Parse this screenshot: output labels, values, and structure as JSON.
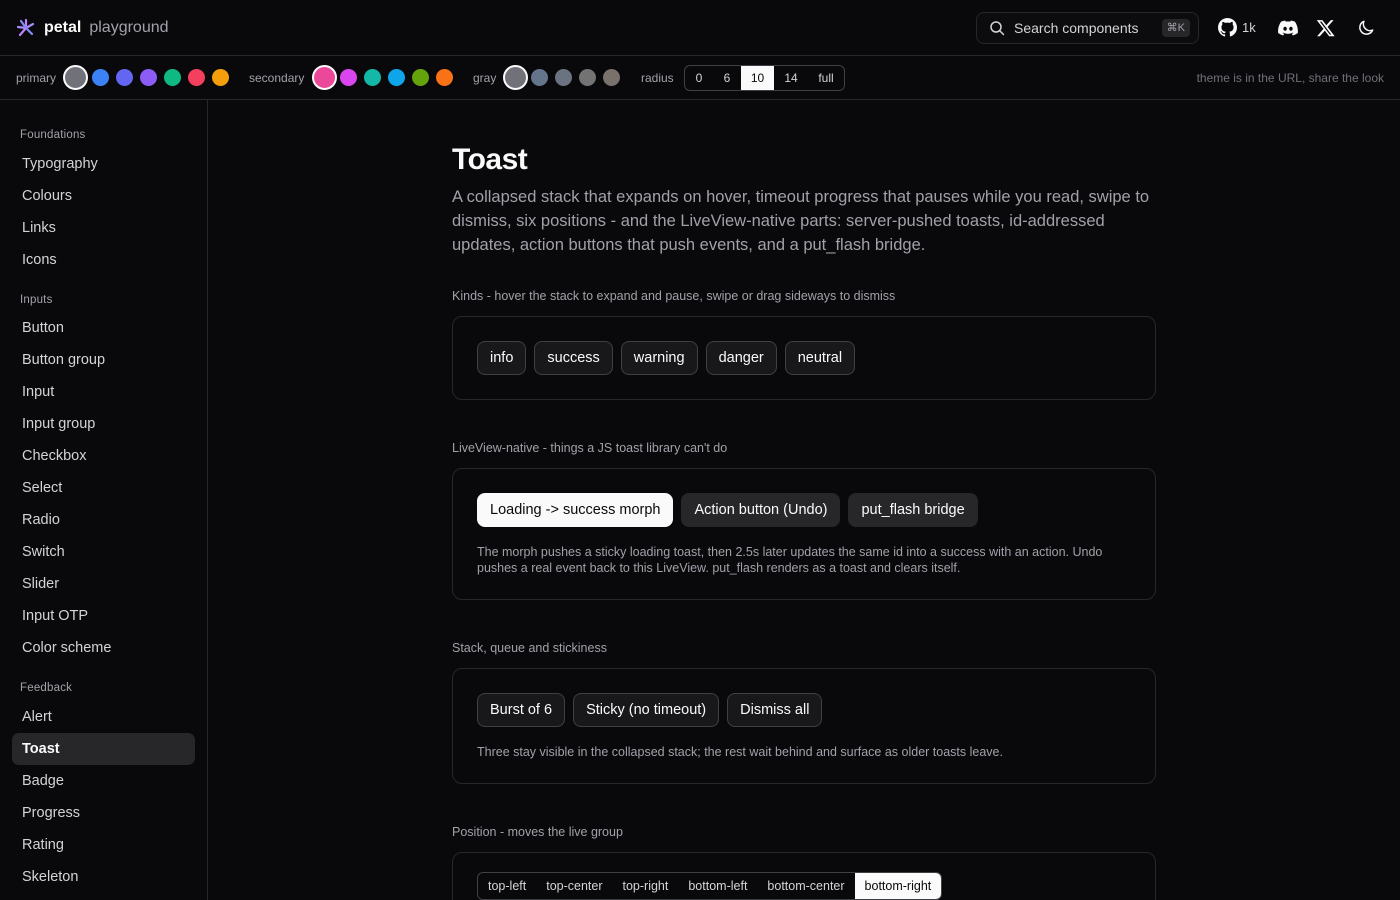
{
  "header": {
    "brand_name": "petal",
    "brand_sub": "playground",
    "search_placeholder": "Search components",
    "search_shortcut": "⌘K",
    "github_count": "1k",
    "icons": [
      "sparkle-logo-icon",
      "search-icon",
      "github-icon",
      "discord-icon",
      "x-icon",
      "moon-icon"
    ]
  },
  "themebar": {
    "primary_label": "primary",
    "primary_colors": [
      "#71717a",
      "#3b82f6",
      "#6366f1",
      "#8b5cf6",
      "#10b981",
      "#f43f5e",
      "#f59e0b"
    ],
    "secondary_label": "secondary",
    "secondary_colors": [
      "#ec4899",
      "#d946ef",
      "#14b8a6",
      "#0ea5e9",
      "#65a30d",
      "#f97316"
    ],
    "gray_label": "gray",
    "gray_colors": [
      "#71717a",
      "#64748b",
      "#6b7280",
      "#737373",
      "#78716c"
    ],
    "radius_label": "radius",
    "radius_options": [
      "0",
      "6",
      "10",
      "14",
      "full"
    ],
    "radius_selected": "10",
    "share_note": "theme is in the URL, share the look"
  },
  "sidebar": {
    "sections": [
      {
        "title": "Foundations",
        "items": [
          "Typography",
          "Colours",
          "Links",
          "Icons"
        ]
      },
      {
        "title": "Inputs",
        "items": [
          "Button",
          "Button group",
          "Input",
          "Input group",
          "Checkbox",
          "Select",
          "Radio",
          "Switch",
          "Slider",
          "Input OTP",
          "Color scheme"
        ]
      },
      {
        "title": "Feedback",
        "items": [
          "Alert",
          "Toast",
          "Badge",
          "Progress",
          "Rating",
          "Skeleton"
        ]
      }
    ],
    "active_item": "Toast"
  },
  "main": {
    "title": "Toast",
    "description": "A collapsed stack that expands on hover, timeout progress that pauses while you read, swipe to dismiss, six positions - and the LiveView-native parts: server-pushed toasts, id-addressed updates, action buttons that push events, and a put_flash bridge.",
    "kinds": {
      "label": "Kinds - hover the stack to expand and pause, swipe or drag sideways to dismiss",
      "buttons": [
        "info",
        "success",
        "warning",
        "danger",
        "neutral"
      ]
    },
    "liveview": {
      "label": "LiveView-native - things a JS toast library can't do",
      "buttons": [
        "Loading -> success morph",
        "Action button (Undo)",
        "put_flash bridge"
      ],
      "note": "The morph pushes a sticky loading toast, then 2.5s later updates the same id into a success with an action. Undo pushes a real event back to this LiveView. put_flash renders as a toast and clears itself."
    },
    "stack": {
      "label": "Stack, queue and stickiness",
      "buttons": [
        "Burst of 6",
        "Sticky (no timeout)",
        "Dismiss all"
      ],
      "note": "Three stay visible in the collapsed stack; the rest wait behind and surface as older toasts leave."
    },
    "position": {
      "label": "Position - moves the live group",
      "options": [
        "top-left",
        "top-center",
        "top-right",
        "bottom-left",
        "bottom-center",
        "bottom-right"
      ],
      "selected": "bottom-right"
    }
  }
}
